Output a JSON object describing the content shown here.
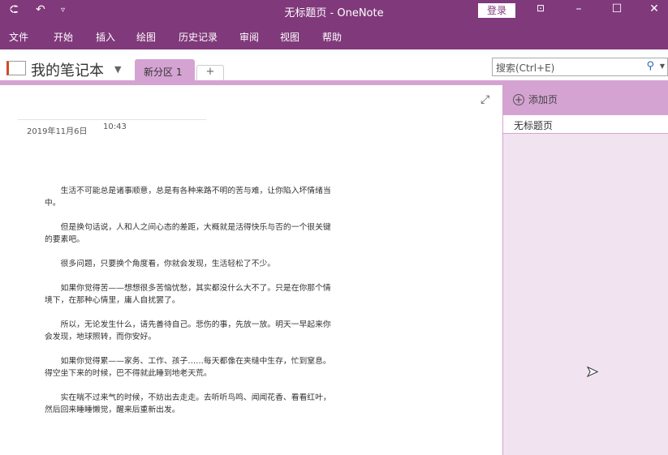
{
  "titlebar": {
    "title": "无标题页  -  OneNote",
    "login": "登录",
    "icons": [
      "back-icon",
      "undo-icon",
      "customize-icon",
      "ribbon-display-icon",
      "minimize-icon",
      "maximize-icon",
      "close-icon"
    ]
  },
  "menu": [
    "文件",
    "开始",
    "插入",
    "绘图",
    "历史记录",
    "审阅",
    "视图",
    "帮助"
  ],
  "notebook": {
    "name": "我的笔记本",
    "section_tab": "新分区 1",
    "add_tab": "+"
  },
  "search": {
    "placeholder": "搜索(Ctrl+E)"
  },
  "page": {
    "date": "2019年11月6日",
    "time": "10:43",
    "paragraphs": [
      "生活不可能总是诸事顺意，总是有各种来路不明的苦与难，让你陷入坏情绪当中。",
      "但是换句话说，人和人之间心态的差距，大概就是活得快乐与否的一个很关键的要素吧。",
      "很多问题，只要换个角度看，你就会发现，生活轻松了不少。",
      "如果你觉得苦——想想很多苦恼忧愁，其实都没什么大不了。只是在你那个情境下，在那种心情里，庸人自扰罢了。",
      "所以，无论发生什么，请先善待自己。悲伤的事，先放一放。明天一早起来你会发现，地球照转，而你安好。",
      "如果你觉得累——家务、工作、孩子……每天都像在夹缝中生存，忙到窒息。得空坐下来的时候，巴不得就此睡到地老天荒。",
      "实在喘不过来气的时候，不妨出去走走。去听听鸟鸣、闻闻花香、看看红叶，然后回来睡睡懒觉，醒来后重新出发。"
    ]
  },
  "pagelist": {
    "add_page": "添加页",
    "pages": [
      "无标题页"
    ]
  },
  "colors": {
    "accent": "#80397b",
    "tab": "#d4a3d2",
    "pane": "#f2e3f1"
  }
}
